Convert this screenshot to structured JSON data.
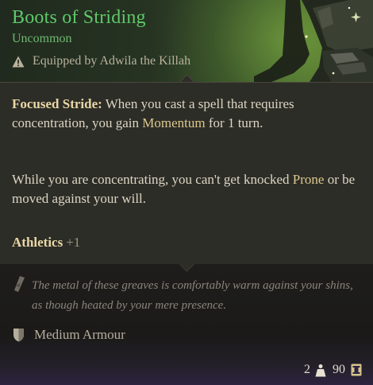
{
  "item": {
    "name": "Boots of Striding",
    "rarity": "Uncommon",
    "equipped_by": "Equipped by Adwila the Killah",
    "icon": "item-boots-art"
  },
  "description": {
    "paragraph1": {
      "feature": "Focused Stride:",
      "text_a": " When you cast a spell that requires concentration, you gain ",
      "keyword": "Momentum",
      "text_b": " for 1 turn."
    },
    "paragraph2": {
      "text_a": "While you are concentrating, you can't get knocked ",
      "keyword": "Prone",
      "text_b": " or be moved against your will."
    },
    "skill": {
      "name": "Athletics",
      "value": "+1"
    }
  },
  "lore": "The metal of these greaves is comfortably warm against your shins, as though heated by your mere presence.",
  "armour_type": "Medium Armour",
  "footer": {
    "weight": "2",
    "value": "90"
  },
  "colors": {
    "rarity_green": "#5fc96a",
    "keyword_gold": "#dcc88e",
    "lore_grey": "#8a857b"
  }
}
